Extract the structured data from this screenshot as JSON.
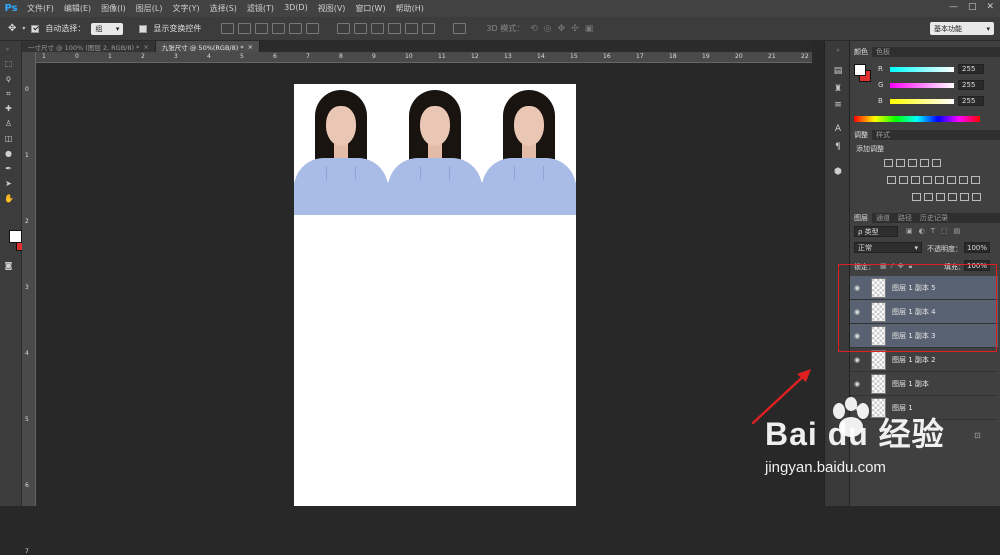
{
  "app": {
    "logo": "Ps"
  },
  "menu": [
    "文件(F)",
    "编辑(E)",
    "图像(I)",
    "图层(L)",
    "文字(Y)",
    "选择(S)",
    "滤镜(T)",
    "3D(D)",
    "视图(V)",
    "窗口(W)",
    "帮助(H)"
  ],
  "window_controls": {
    "minimize": "—",
    "maximize": "□",
    "close": "✕"
  },
  "options_bar": {
    "auto_select_label": "自动选择：",
    "auto_select_value": "组",
    "show_transform_label": "显示变换控件",
    "mode_3d_label": "3D 模式：",
    "workspace": "基本功能"
  },
  "tabs": [
    {
      "label": "一寸尺寸 @ 100% (图层 2, RGB/8) *",
      "close": "×"
    },
    {
      "label": "九张尺寸 @ 50%(RGB/8) *",
      "close": "×"
    }
  ],
  "ruler_top": [
    "1",
    "0",
    "1",
    "2",
    "3",
    "4",
    "5",
    "6",
    "7",
    "8",
    "9",
    "10",
    "11",
    "12",
    "13",
    "14",
    "15",
    "16",
    "17",
    "18",
    "19",
    "20",
    "21",
    "22"
  ],
  "ruler_left": [
    "0",
    "1",
    "2",
    "3",
    "4",
    "5",
    "6",
    "7"
  ],
  "color_panel": {
    "tabs": [
      "颜色",
      "色板"
    ],
    "rows": [
      {
        "label": "R",
        "value": "255"
      },
      {
        "label": "G",
        "value": "255"
      },
      {
        "label": "B",
        "value": "255"
      }
    ]
  },
  "adjust_panel": {
    "tabs": [
      "调整",
      "样式"
    ],
    "title": "添加调整"
  },
  "layers_panel": {
    "tabs": [
      "图层",
      "通道",
      "路径",
      "历史记录"
    ],
    "filter_label": "ρ 类型",
    "blend_mode": "正常",
    "opacity_label": "不透明度：",
    "opacity_value": "100%",
    "lock_label": "锁定：",
    "fill_label": "填充：",
    "fill_value": "100%",
    "layers": [
      {
        "name": "图层 1 副本 5",
        "selected": true
      },
      {
        "name": "图层 1 副本 4",
        "selected": true
      },
      {
        "name": "图层 1 副本 3",
        "selected": true
      },
      {
        "name": "图层 1 副本 2",
        "selected": false
      },
      {
        "name": "图层 1 副本",
        "selected": false
      },
      {
        "name": "图层 1",
        "selected": false
      }
    ]
  },
  "watermark": {
    "brand": "Bai du 经验",
    "url": "jingyan.baidu.com"
  }
}
